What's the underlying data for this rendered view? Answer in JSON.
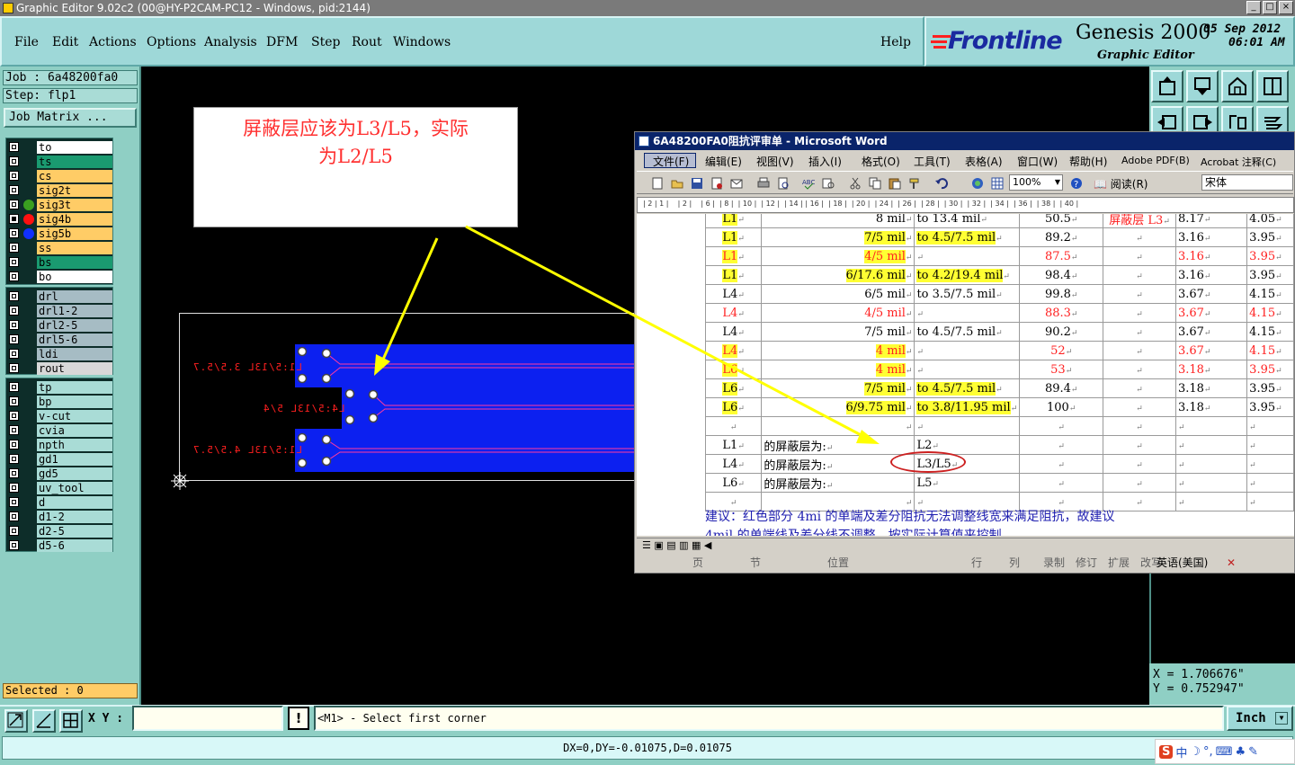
{
  "window": {
    "title": "Graphic Editor 9.02c2 (00@HY-P2CAM-PC12 - Windows, pid:2144)",
    "buttons": [
      "_",
      "□",
      "×"
    ]
  },
  "menu": {
    "items": [
      "File",
      "Edit",
      "Actions",
      "Options",
      "Analysis",
      "DFM",
      "Step",
      "Rout",
      "Windows"
    ],
    "help": "Help"
  },
  "brand": {
    "logo": "Frontline",
    "product": "Genesis 2000",
    "subtitle": "Graphic Editor",
    "date": "05 Sep 2012",
    "time": "06:01 AM"
  },
  "job": {
    "job_label": "Job : 6a48200fa0",
    "step_label": "Step: flp1",
    "matrix_button": "Job Matrix ..."
  },
  "layers": {
    "group1": [
      {
        "name": "to",
        "color": "#ffffff",
        "dot": "",
        "checked": false
      },
      {
        "name": "ts",
        "color": "#1a9a70",
        "dot": "",
        "checked": false
      },
      {
        "name": "cs",
        "color": "#ffcc66",
        "dot": "",
        "checked": false
      },
      {
        "name": "sig2t",
        "color": "#ffcc66",
        "dot": "",
        "checked": false
      },
      {
        "name": "sig3t",
        "color": "#ffcc66",
        "dot": "#3aa020",
        "checked": false
      },
      {
        "name": "sig4b",
        "color": "#ffcc66",
        "dot": "#ff1010",
        "checked": true
      },
      {
        "name": "sig5b",
        "color": "#ffcc66",
        "dot": "#1030ff",
        "checked": false
      },
      {
        "name": "ss",
        "color": "#ffcc66",
        "dot": "",
        "checked": false
      },
      {
        "name": "bs",
        "color": "#1a9a70",
        "dot": "",
        "checked": false
      },
      {
        "name": "bo",
        "color": "#ffffff",
        "dot": "",
        "checked": false
      }
    ],
    "group2": [
      {
        "name": "drl",
        "color": "#a6bcc4",
        "dot": "",
        "checked": false
      },
      {
        "name": "drl1-2",
        "color": "#a6bcc4",
        "dot": "",
        "checked": false
      },
      {
        "name": "drl2-5",
        "color": "#a6bcc4",
        "dot": "",
        "checked": false
      },
      {
        "name": "drl5-6",
        "color": "#a6bcc4",
        "dot": "",
        "checked": false
      },
      {
        "name": "ldi",
        "color": "#a6bcc4",
        "dot": "",
        "checked": false
      },
      {
        "name": "rout",
        "color": "#d8d8d8",
        "dot": "",
        "checked": false
      }
    ],
    "group3": [
      {
        "name": "tp",
        "color": "#a9dcd6",
        "dot": "",
        "checked": false
      },
      {
        "name": "bp",
        "color": "#a9dcd6",
        "dot": "",
        "checked": false
      },
      {
        "name": "v-cut",
        "color": "#a9dcd6",
        "dot": "",
        "checked": false
      },
      {
        "name": "cvia",
        "color": "#a9dcd6",
        "dot": "",
        "checked": false
      },
      {
        "name": "npth",
        "color": "#a9dcd6",
        "dot": "",
        "checked": false
      },
      {
        "name": "gd1",
        "color": "#a9dcd6",
        "dot": "",
        "checked": false
      },
      {
        "name": "gd5",
        "color": "#a9dcd6",
        "dot": "",
        "checked": false
      },
      {
        "name": "uv_tool",
        "color": "#a9dcd6",
        "dot": "",
        "checked": false
      },
      {
        "name": "d",
        "color": "#a9dcd6",
        "dot": "",
        "checked": false
      },
      {
        "name": "d1-2",
        "color": "#a9dcd6",
        "dot": "",
        "checked": false
      },
      {
        "name": "d2-5",
        "color": "#a9dcd6",
        "dot": "",
        "checked": false
      },
      {
        "name": "d5-6",
        "color": "#a9dcd6",
        "dot": "",
        "checked": false
      }
    ]
  },
  "selected_label": "Selected : 0",
  "callout": {
    "line1": "屏蔽层应该为L3/L5，实际",
    "line2": "为L2/L5"
  },
  "canvas_labels": {
    "top": "L1:5/13L 3.5/5.7",
    "mid": "L4:5/13L 5/4",
    "bot": "L1:5/13L 4.5/5.7"
  },
  "word": {
    "title": "6A48200FA0阻抗评审单 - Microsoft Word",
    "menus": [
      "文件(F)",
      "编辑(E)",
      "视图(V)",
      "插入(I)",
      "格式(O)",
      "工具(T)",
      "表格(A)",
      "窗口(W)",
      "帮助(H)",
      "Adobe PDF(B)",
      "Acrobat 注释(C)"
    ],
    "zoom": "100%",
    "read_btn": "阅读(R)",
    "font": "宋体",
    "ruler": "| 2 | 1 |    | 2 |    | 6 |  | 8 |  | 10 |  | 12 |  | 14 | | 16 |  | 18 |  | 20 |  | 24 |  | 26 |  | 28 |  | 30 |  | 32 |  | 34 |  | 36 |  | 38 |  | 40 |",
    "rows": [
      {
        "c1": "L1",
        "c2": "8 mil",
        "c3": "to 13.4 mil",
        "c4": "50.5",
        "c5": "屏蔽层 L3",
        "c6": "8.17",
        "c7": "4.05",
        "hl1": true,
        "hl2": false,
        "hl3": false,
        "red": false,
        "c5red": true
      },
      {
        "c1": "L1",
        "c2": "7/5 mil",
        "c3": "to 4.5/7.5 mil",
        "c4": "89.2",
        "c5": "",
        "c6": "3.16",
        "c7": "3.95",
        "hl1": true,
        "hl2": true,
        "hl3": true,
        "red": false,
        "c5red": false
      },
      {
        "c1": "L1",
        "c2": "4/5 mil",
        "c3": "",
        "c4": "87.5",
        "c5": "",
        "c6": "3.16",
        "c7": "3.95",
        "hl1": true,
        "hl2": true,
        "hl3": false,
        "red": true,
        "c5red": false
      },
      {
        "c1": "L1",
        "c2": "6/17.6 mil",
        "c3": "to 4.2/19.4 mil",
        "c4": "98.4",
        "c5": "",
        "c6": "3.16",
        "c7": "3.95",
        "hl1": true,
        "hl2": true,
        "hl3": true,
        "red": false,
        "c5red": false
      },
      {
        "c1": "L4",
        "c2": "6/5 mil",
        "c3": "to 3.5/7.5 mil",
        "c4": "99.8",
        "c5": "",
        "c6": "3.67",
        "c7": "4.15",
        "hl1": false,
        "hl2": false,
        "hl3": false,
        "red": false,
        "c5red": false
      },
      {
        "c1": "L4",
        "c2": "4/5 mil",
        "c3": "",
        "c4": "88.3",
        "c5": "",
        "c6": "3.67",
        "c7": "4.15",
        "hl1": false,
        "hl2": false,
        "hl3": false,
        "red": true,
        "c5red": false
      },
      {
        "c1": "L4",
        "c2": "7/5 mil",
        "c3": "to 4.5/7.5 mil",
        "c4": "90.2",
        "c5": "",
        "c6": "3.67",
        "c7": "4.15",
        "hl1": false,
        "hl2": false,
        "hl3": false,
        "red": false,
        "c5red": false
      },
      {
        "c1": "L4",
        "c2": "4 mil",
        "c3": "",
        "c4": "52",
        "c5": "",
        "c6": "3.67",
        "c7": "4.15",
        "hl1": true,
        "hl2": true,
        "hl3": false,
        "red": true,
        "c5red": false
      },
      {
        "c1": "L6",
        "c2": "4 mil",
        "c3": "",
        "c4": "53",
        "c5": "",
        "c6": "3.18",
        "c7": "3.95",
        "hl1": true,
        "hl2": true,
        "hl3": false,
        "red": true,
        "c5red": false
      },
      {
        "c1": "L6",
        "c2": "7/5 mil",
        "c3": "to 4.5/7.5 mil",
        "c4": "89.4",
        "c5": "",
        "c6": "3.18",
        "c7": "3.95",
        "hl1": true,
        "hl2": true,
        "hl3": true,
        "red": false,
        "c5red": false
      },
      {
        "c1": "L6",
        "c2": "6/9.75 mil",
        "c3": "to 3.8/11.95 mil",
        "c4": "100",
        "c5": "",
        "c6": "3.18",
        "c7": "3.95",
        "hl1": true,
        "hl2": true,
        "hl3": true,
        "red": false,
        "c5red": false
      },
      {
        "c1": "",
        "c2": "",
        "c3": "",
        "c4": "",
        "c5": "",
        "c6": "",
        "c7": "",
        "hl1": false,
        "hl2": false,
        "hl3": false,
        "red": false,
        "c5red": false
      },
      {
        "c1": "L1",
        "c2": "的屏蔽层为:",
        "c3": "L2",
        "c4": "",
        "c5": "",
        "c6": "",
        "c7": "",
        "hl1": false,
        "hl2": false,
        "hl3": false,
        "red": false,
        "c5red": false,
        "left": true
      },
      {
        "c1": "L4",
        "c2": "的屏蔽层为:",
        "c3": "L3/L5",
        "c4": "",
        "c5": "",
        "c6": "",
        "c7": "",
        "hl1": false,
        "hl2": false,
        "hl3": false,
        "red": false,
        "c5red": false,
        "left": true
      },
      {
        "c1": "L6",
        "c2": "的屏蔽层为:",
        "c3": "L5",
        "c4": "",
        "c5": "",
        "c6": "",
        "c7": "",
        "hl1": false,
        "hl2": false,
        "hl3": false,
        "red": false,
        "c5red": false,
        "left": true
      },
      {
        "c1": "",
        "c2": "",
        "c3": "",
        "c4": "",
        "c5": "",
        "c6": "",
        "c7": "",
        "hl1": false,
        "hl2": false,
        "hl3": false,
        "red": false,
        "c5red": false
      }
    ],
    "suggest_line1": "建议：红色部分 4mi 的单端及差分阻抗无法调整线宽来满足阻抗，故建议",
    "suggest_line2": "4mil 的单端线及差分线不调整，按实际计算值来控制。",
    "status": [
      "页",
      "节",
      "位置",
      "行",
      "列",
      "录制",
      "修订",
      "扩展",
      "改写",
      "英语(美国)"
    ]
  },
  "coords": {
    "x": "X = 1.706676\"",
    "y": "Y = 0.752947\""
  },
  "bottom": {
    "xy_label": "X Y :",
    "xy_value": "",
    "warn": "!",
    "prompt": "<M1> - Select first corner",
    "units": "Inch",
    "measure": "DX=0,DY=-0.01075,D=0.01075"
  },
  "tray": [
    "中",
    "☽",
    "°,",
    "⌨",
    "♣",
    "✎"
  ],
  "colors": {
    "board": "#0c20f0",
    "trace": "#ff3aa0",
    "arrow": "#ffff00",
    "menu_bg": "#9ed8d8",
    "panel_bg": "#8fcfc4"
  }
}
